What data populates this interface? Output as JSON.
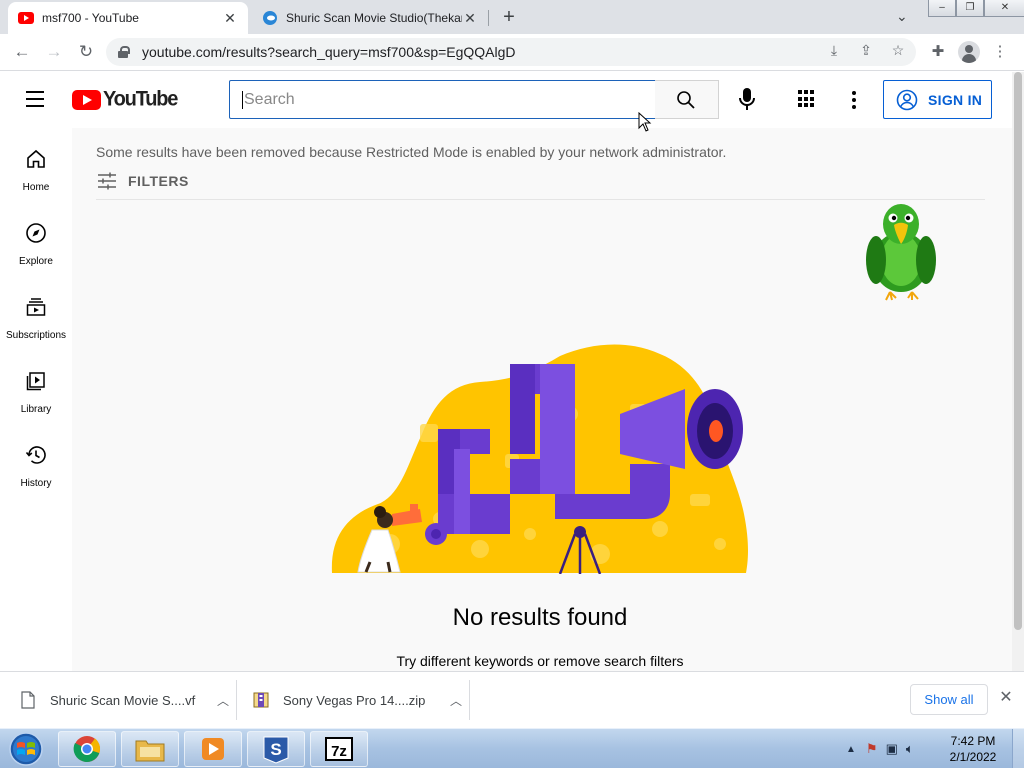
{
  "browser": {
    "tabs": [
      {
        "title": "msf700 - YouTube",
        "active": true
      },
      {
        "title": "Shuric Scan Movie Studio(Thekar",
        "active": false
      }
    ],
    "url": "youtube.com/results?search_query=msf700&sp=EgQQAlgD"
  },
  "youtube": {
    "logo_text": "YouTube",
    "search_placeholder": "Search",
    "sign_in_label": "SIGN IN",
    "sidebar": [
      {
        "label": "Home",
        "icon": "home-icon"
      },
      {
        "label": "Explore",
        "icon": "compass-icon"
      },
      {
        "label": "Subscriptions",
        "icon": "subscriptions-icon"
      },
      {
        "label": "Library",
        "icon": "library-icon"
      },
      {
        "label": "History",
        "icon": "history-icon"
      }
    ],
    "notice": "Some results have been removed because Restricted Mode is enabled by your network administrator.",
    "filters_label": "FILTERS",
    "no_results_title": "No results found",
    "no_results_hint": "Try different keywords or remove search filters"
  },
  "downloads": {
    "items": [
      {
        "name": "Shuric Scan Movie S....vf",
        "icon": "file-icon"
      },
      {
        "name": "Sony Vegas Pro 14....zip",
        "icon": "zip-icon"
      }
    ],
    "show_all_label": "Show all"
  },
  "taskbar": {
    "time": "7:42 PM",
    "date": "2/1/2022",
    "apps": [
      "chrome",
      "file-explorer",
      "media-player",
      "shuric-scan",
      "7-zip"
    ]
  },
  "colors": {
    "youtube_red": "#ff0000",
    "link_blue": "#065fd4",
    "illustration_yellow": "#ffc107",
    "illustration_purple": "#6a3ccf"
  }
}
